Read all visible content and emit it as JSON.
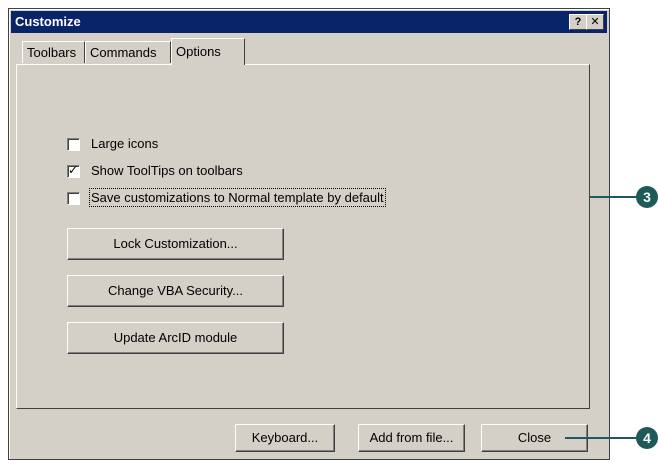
{
  "window": {
    "title": "Customize",
    "help_glyph": "?",
    "close_glyph": "✕"
  },
  "tabs": [
    {
      "label": "Toolbars",
      "active": false
    },
    {
      "label": "Commands",
      "active": false
    },
    {
      "label": "Options",
      "active": true
    }
  ],
  "options": {
    "checkboxes": [
      {
        "label": "Large icons",
        "checked": false
      },
      {
        "label": "Show ToolTips on toolbars",
        "checked": true
      },
      {
        "label": "Save customizations to Normal template by default",
        "checked": false
      }
    ],
    "buttons": [
      {
        "label": "Lock Customization..."
      },
      {
        "label": "Change VBA Security..."
      },
      {
        "label": "Update ArcID module"
      }
    ]
  },
  "footer": {
    "keyboard_label": "Keyboard...",
    "add_from_file_label": "Add from file...",
    "close_label": "Close"
  },
  "callouts": [
    {
      "number": "3"
    },
    {
      "number": "4"
    }
  ],
  "colors": {
    "title_bar": "#0a246a",
    "dialog_face": "#d4d0c8",
    "callout": "#1e5a5a"
  }
}
